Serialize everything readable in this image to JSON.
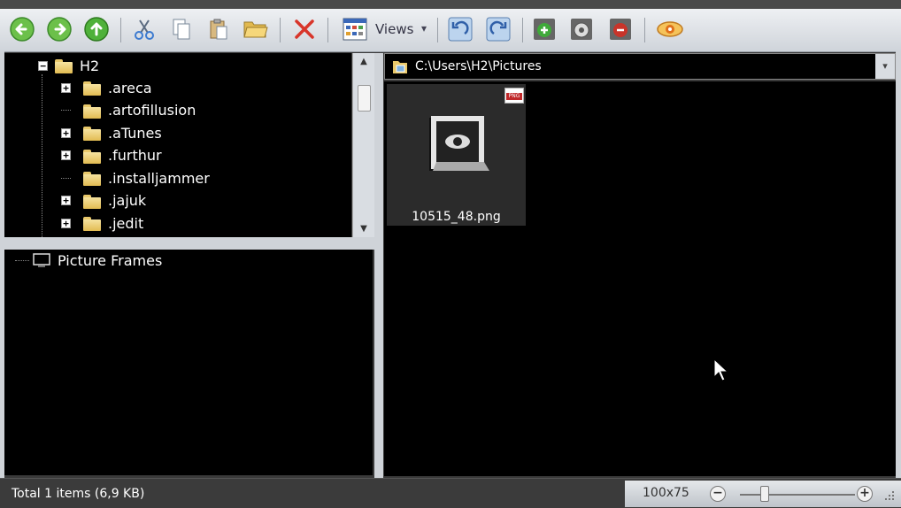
{
  "toolbar": {
    "views_label": "Views",
    "icons": [
      "back-icon",
      "forward-icon",
      "up-icon",
      "cut-icon",
      "copy-icon",
      "paste-icon",
      "open-folder-icon",
      "delete-icon",
      "views-icon",
      "rotate-left-icon",
      "rotate-right-icon",
      "add-frame-icon",
      "settings-frame-icon",
      "remove-frame-icon",
      "preview-eye-icon"
    ]
  },
  "tree": {
    "root": "H2",
    "items": [
      {
        "label": ".areca",
        "expandable": true
      },
      {
        "label": ".artofillusion",
        "expandable": false
      },
      {
        "label": ".aTunes",
        "expandable": true
      },
      {
        "label": ".furthur",
        "expandable": true
      },
      {
        "label": ".installjammer",
        "expandable": false
      },
      {
        "label": ".jajuk",
        "expandable": true
      },
      {
        "label": ".jedit",
        "expandable": true
      }
    ]
  },
  "frames": {
    "item": "Picture Frames"
  },
  "path": {
    "value": "C:\\Users\\H2\\Pictures"
  },
  "files": [
    {
      "name": "10515_48.png",
      "badge": "PNG"
    }
  ],
  "status": {
    "summary": "Total 1 items (6,9 KB)",
    "zoom_label": "100x75"
  },
  "colors": {
    "panel_bg": "#000000",
    "toolbar_bg": "#dde1e6",
    "folder": "#e9c86a"
  }
}
